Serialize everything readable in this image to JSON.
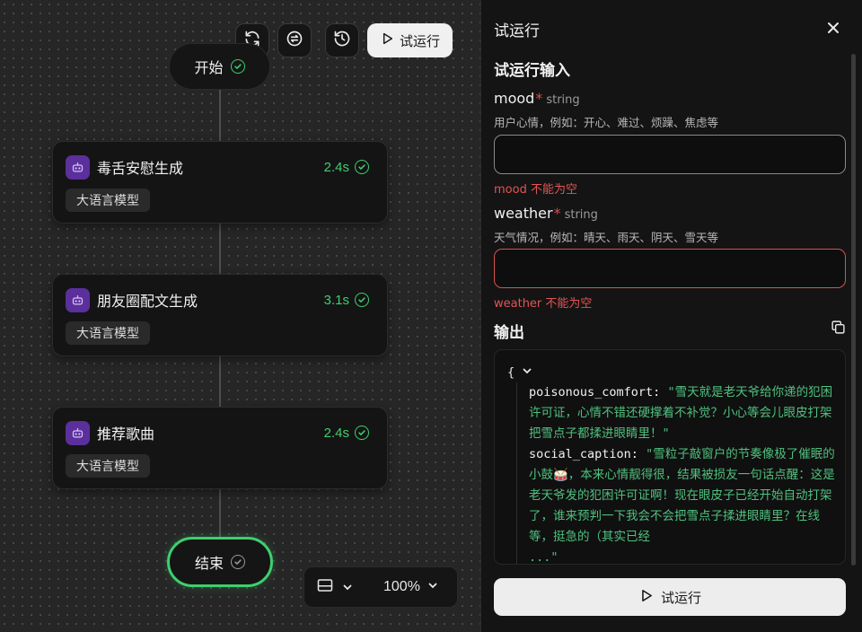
{
  "toolbar": {
    "run_label": "试运行"
  },
  "flow": {
    "start_label": "开始",
    "end_label": "结束",
    "nodes": [
      {
        "title": "毒舌安慰生成",
        "time": "2.4s",
        "tag": "大语言模型"
      },
      {
        "title": "朋友圈配文生成",
        "time": "3.1s",
        "tag": "大语言模型"
      },
      {
        "title": "推荐歌曲",
        "time": "2.4s",
        "tag": "大语言模型"
      }
    ],
    "zoom": "100%"
  },
  "panel": {
    "title": "试运行",
    "input_section": "试运行输入",
    "fields": [
      {
        "name": "mood",
        "type": "string",
        "desc": "用户心情，例如：开心、难过、烦躁、焦虑等",
        "value": "",
        "error": "mood 不能为空"
      },
      {
        "name": "weather",
        "type": "string",
        "desc": "天气情况，例如：晴天、雨天、阴天、雪天等",
        "value": "",
        "error": "weather 不能为空"
      }
    ],
    "output_section": "输出",
    "output": {
      "open_brace": "{",
      "key1": "poisonous_comfort:",
      "val1": "\"雪天就是老天爷给你递的犯困许可证，心情不错还硬撑着不补觉？小心等会儿眼皮打架把雪点子都揉进眼睛里！\"",
      "key2": "social_caption:",
      "val2": "\"雪粒子敲窗户的节奏像极了催眠的小鼓🥁，本来心情靓得很，结果被损友一句话点醒：这是老天爷发的犯困许可证啊！现在眼皮子已经开始自动打架了，谁来预判一下我会不会把雪点子揉进眼睛里？在线等，挺急的（其实已经",
      "ellipsis": "...\""
    },
    "run_button": "试运行"
  },
  "colors": {
    "success": "#3ecf6e",
    "error": "#e35454",
    "node_icon_bg": "#5b2f9c"
  }
}
